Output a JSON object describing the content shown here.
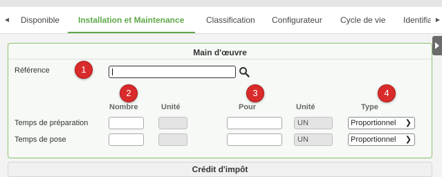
{
  "tabs": [
    {
      "label": "Disponible"
    },
    {
      "label": "Installation et Maintenance"
    },
    {
      "label": "Classification"
    },
    {
      "label": "Configurateur"
    },
    {
      "label": "Cycle de vie"
    },
    {
      "label": "Identifia"
    }
  ],
  "active_tab": "Installation et Maintenance",
  "colors": {
    "accent": "#5fa84a",
    "badge": "#d92b2b"
  },
  "labor": {
    "title": "Main d'œuvre",
    "reference_label": "Référence",
    "reference_value": "",
    "columns": {
      "nombre": "Nombre",
      "unite": "Unité",
      "pour": "Pour",
      "unite2": "Unité",
      "type": "Type"
    },
    "rows": [
      {
        "label": "Temps de préparation",
        "nombre": "",
        "unite": "",
        "pour": "",
        "pour_unit": "UN",
        "type": "Proportionnel"
      },
      {
        "label": "Temps de pose",
        "nombre": "",
        "unite": "",
        "pour": "",
        "pour_unit": "UN",
        "type": "Proportionnel"
      }
    ]
  },
  "badges": [
    "1",
    "2",
    "3",
    "4"
  ],
  "next_section": {
    "title": "Crédit d'impôt"
  },
  "icons": {
    "tabs_left": "chevron-left-icon",
    "tabs_right": "chevron-right-icon",
    "search": "search-icon",
    "side_panel": "side-panel-toggle-icon",
    "select": "chevron-down-icon"
  }
}
